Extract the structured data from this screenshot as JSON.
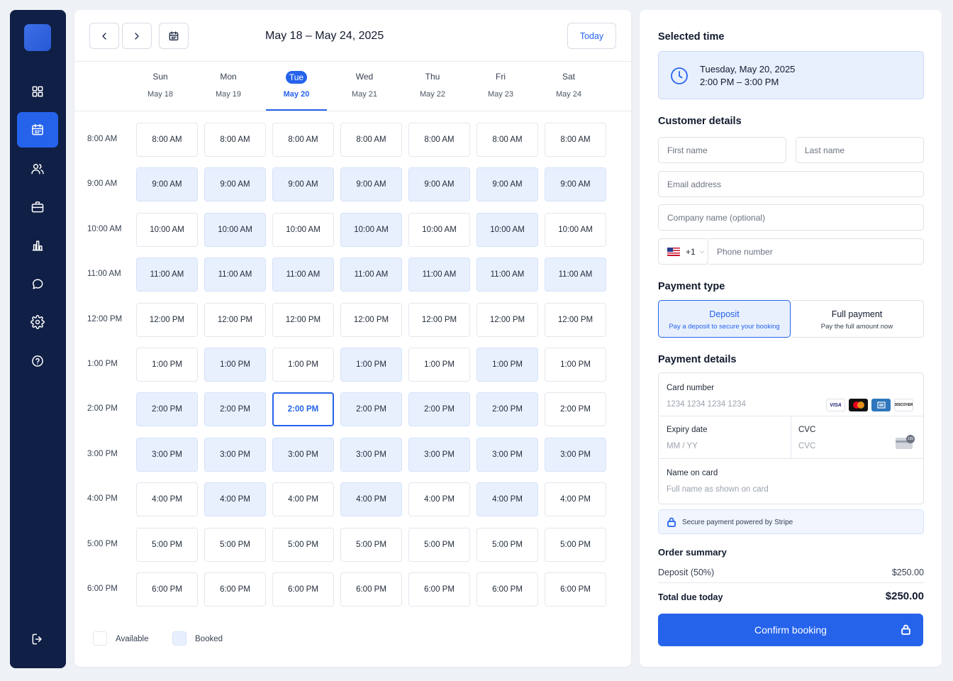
{
  "sidebar": {
    "items": [
      {
        "icon": "dashboard-grid-icon",
        "active": false
      },
      {
        "icon": "calendar-icon",
        "active": true
      },
      {
        "icon": "users-icon",
        "active": false
      },
      {
        "icon": "briefcase-icon",
        "active": false
      },
      {
        "icon": "bar-chart-icon",
        "active": false
      },
      {
        "icon": "chat-bubble-icon",
        "active": false
      },
      {
        "icon": "gear-icon",
        "active": false
      },
      {
        "icon": "help-circle-icon",
        "active": false
      }
    ],
    "logout_icon": "logout-icon"
  },
  "calendar": {
    "range_title": "May 18 – May 24, 2025",
    "today_label": "Today",
    "days": [
      {
        "name": "Sun",
        "date": "May 18"
      },
      {
        "name": "Mon",
        "date": "May 19"
      },
      {
        "name": "Tue",
        "date": "May 20"
      },
      {
        "name": "Wed",
        "date": "May 21"
      },
      {
        "name": "Thu",
        "date": "May 22"
      },
      {
        "name": "Fri",
        "date": "May 23"
      },
      {
        "name": "Sat",
        "date": "May 24"
      }
    ],
    "selected_day_index": 2,
    "times": [
      "8:00 AM",
      "9:00 AM",
      "10:00 AM",
      "11:00 AM",
      "12:00 PM",
      "1:00 PM",
      "2:00 PM",
      "3:00 PM",
      "4:00 PM",
      "5:00 PM",
      "6:00 PM"
    ],
    "booked": [
      [
        0,
        0,
        0,
        0,
        0,
        0,
        0
      ],
      [
        1,
        1,
        1,
        1,
        1,
        1,
        1
      ],
      [
        0,
        1,
        0,
        1,
        0,
        1,
        0
      ],
      [
        1,
        1,
        1,
        1,
        1,
        1,
        1
      ],
      [
        0,
        0,
        0,
        0,
        0,
        0,
        0
      ],
      [
        0,
        1,
        0,
        1,
        0,
        1,
        0
      ],
      [
        1,
        1,
        0,
        1,
        1,
        1,
        0
      ],
      [
        1,
        1,
        1,
        1,
        1,
        1,
        1
      ],
      [
        0,
        1,
        0,
        1,
        0,
        1,
        0
      ],
      [
        0,
        0,
        0,
        0,
        0,
        0,
        0
      ],
      [
        0,
        0,
        0,
        0,
        0,
        0,
        0
      ]
    ],
    "selected_slot": {
      "row": 6,
      "col": 2
    },
    "legend": {
      "available": "Available",
      "booked": "Booked"
    }
  },
  "colors": {
    "accent": "#2563eb",
    "sidebar": "#0f1f45",
    "booked_bg": "#e8f0fe"
  },
  "selected_time": {
    "title": "Selected time",
    "date_line": "Tuesday, May 20, 2025",
    "time_line": "2:00 PM – 3:00 PM"
  },
  "customer": {
    "title": "Customer details",
    "first_name_placeholder": "First name",
    "last_name_placeholder": "Last name",
    "email_placeholder": "Email address",
    "company_placeholder": "Company name (optional)",
    "country_code": "+1",
    "phone_placeholder": "Phone number"
  },
  "payment_type": {
    "title": "Payment type",
    "options": [
      {
        "label": "Deposit",
        "desc": "Pay a deposit to secure your booking",
        "selected": true
      },
      {
        "label": "Full payment",
        "desc": "Pay the full amount now",
        "selected": false
      }
    ]
  },
  "payment_details": {
    "title": "Payment details",
    "card_number_label": "Card number",
    "card_number_placeholder": "1234 1234 1234 1234",
    "brands": [
      "VISA",
      "mastercard",
      "AMEX",
      "DISCOVER"
    ],
    "expiry_label": "Expiry date",
    "expiry_placeholder": "MM / YY",
    "cvc_label": "CVC",
    "cvc_placeholder": "CVC",
    "cvc_icon_text": "135",
    "name_label": "Name on card",
    "name_placeholder": "Full name as shown on card",
    "secure_text": "Secure payment powered by Stripe"
  },
  "summary": {
    "title": "Order summary",
    "deposit_label": "Deposit (50%)",
    "deposit_value": "$250.00",
    "total_label": "Total due today",
    "total_value": "$250.00"
  },
  "confirm_label": "Confirm booking"
}
